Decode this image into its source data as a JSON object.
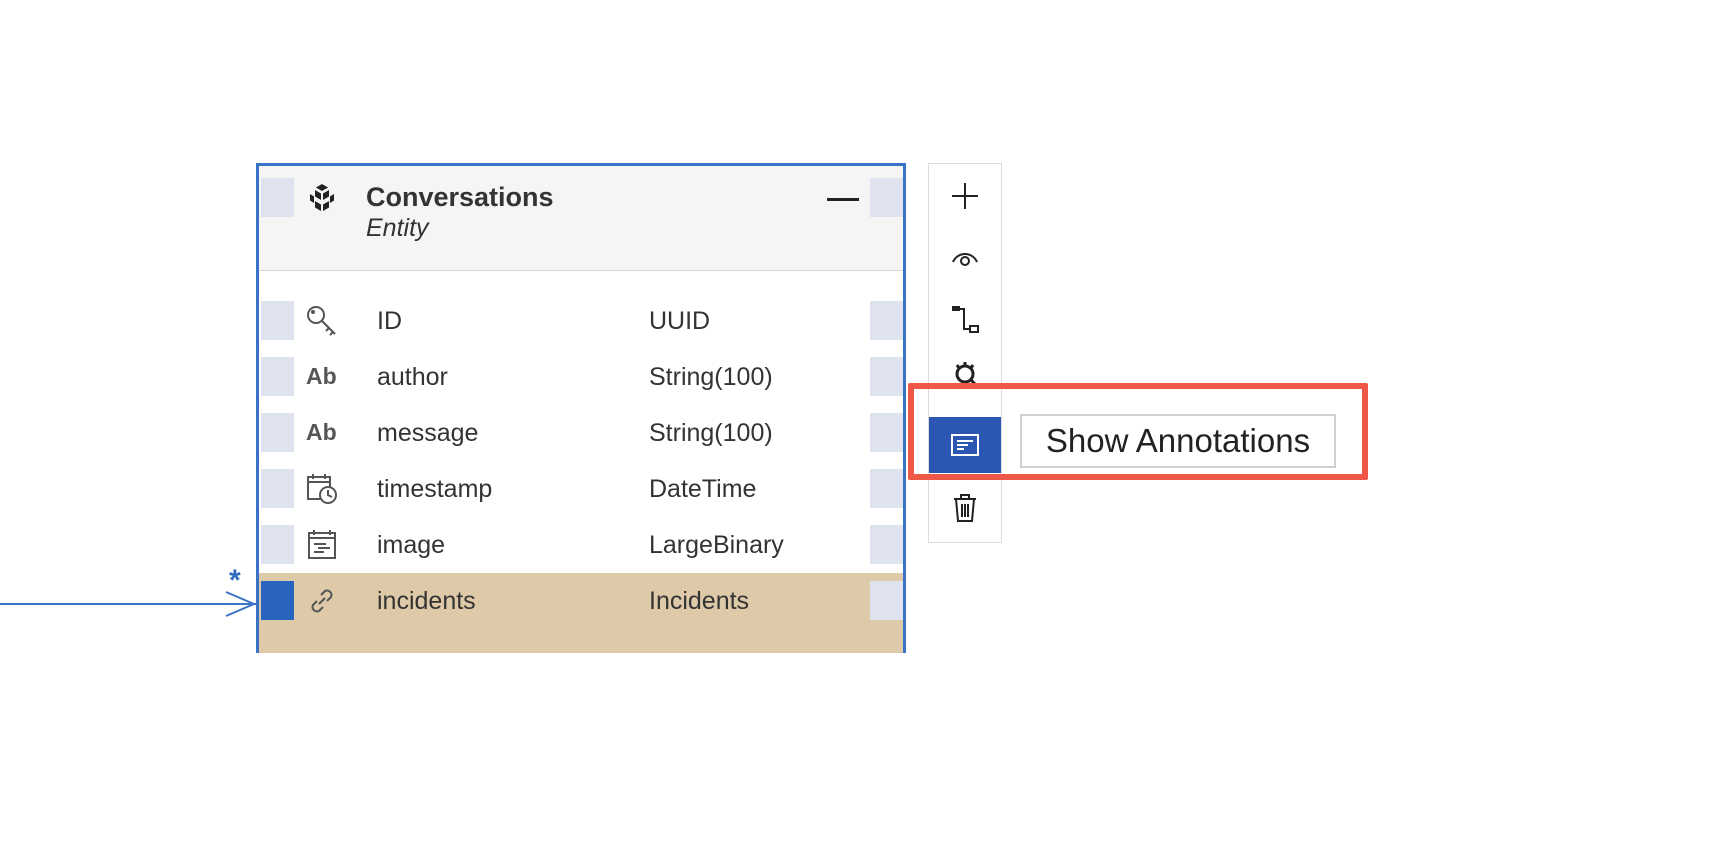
{
  "entity": {
    "title": "Conversations",
    "subtitle": "Entity",
    "icon": "entity-cube-icon",
    "attributes": [
      {
        "name": "ID",
        "type": "UUID",
        "icon": "key-icon"
      },
      {
        "name": "author",
        "type": "String(100)",
        "icon": "string-icon",
        "icon_text": "Ab"
      },
      {
        "name": "message",
        "type": "String(100)",
        "icon": "string-icon",
        "icon_text": "Ab"
      },
      {
        "name": "timestamp",
        "type": "DateTime",
        "icon": "datetime-icon"
      },
      {
        "name": "image",
        "type": "LargeBinary",
        "icon": "binary-icon"
      },
      {
        "name": "incidents",
        "type": "Incidents",
        "icon": "link-icon",
        "selected": true
      }
    ]
  },
  "relationship": {
    "cardinality": "*"
  },
  "toolbar": {
    "buttons": [
      {
        "name": "add",
        "icon": "plus-icon"
      },
      {
        "name": "view",
        "icon": "eye-icon"
      },
      {
        "name": "association",
        "icon": "association-icon"
      },
      {
        "name": "settings",
        "icon": "gear-icon"
      },
      {
        "name": "show-annotations",
        "icon": "annotation-icon",
        "active": true
      },
      {
        "name": "delete",
        "icon": "trash-icon"
      }
    ]
  },
  "tooltip": {
    "text": "Show Annotations"
  },
  "colors": {
    "card_border": "#3a72c6",
    "selected_row": "#decaa8",
    "active_button": "#2b56b2",
    "highlight": "#ef5848"
  }
}
